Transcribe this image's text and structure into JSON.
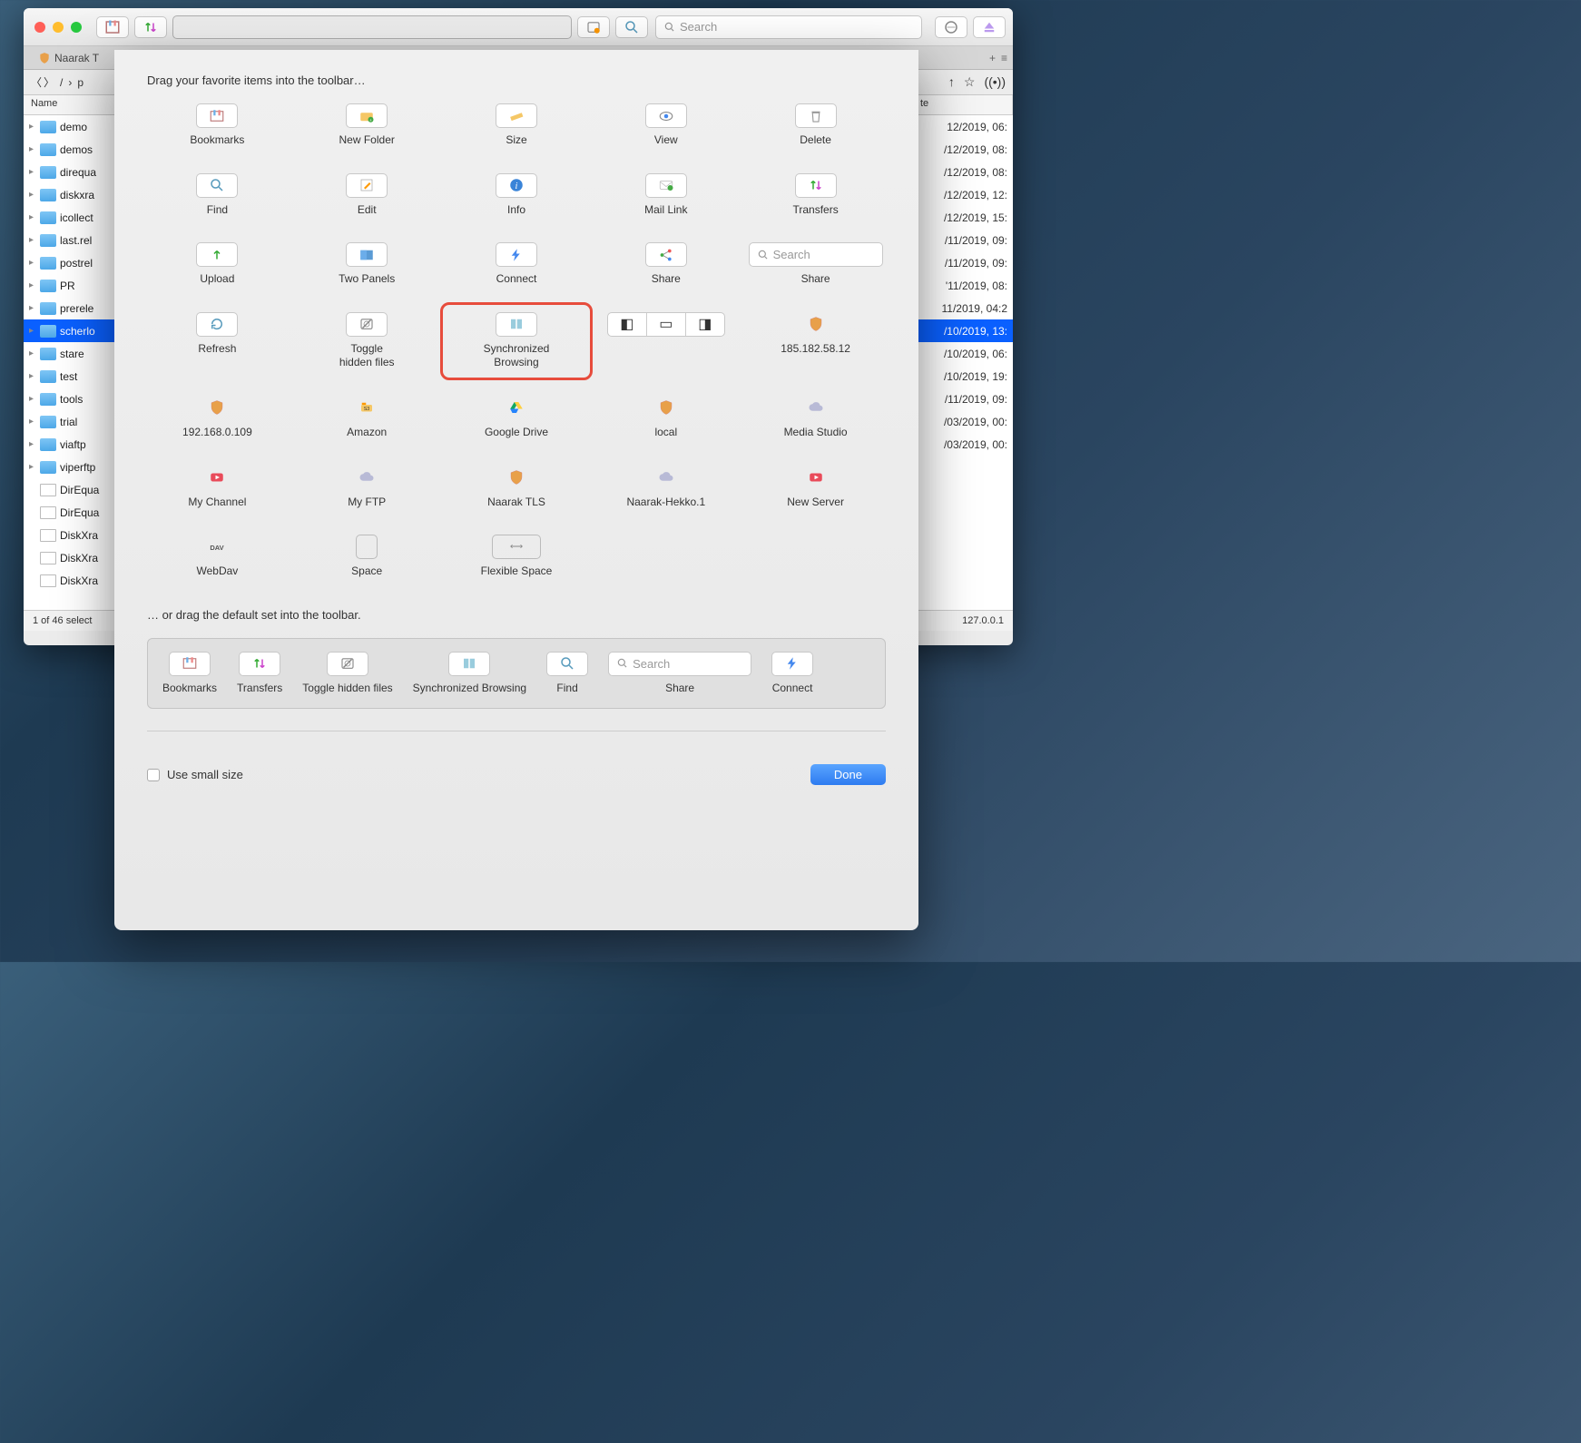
{
  "toolbar": {
    "search_placeholder": "Search"
  },
  "tab": {
    "title": "Naarak T"
  },
  "path": {
    "crumb": "p"
  },
  "columns": {
    "name": "Name",
    "date": "te"
  },
  "files": [
    {
      "name": "demo",
      "type": "folder",
      "date": "12/2019, 06:",
      "sel": false
    },
    {
      "name": "demos",
      "type": "folder",
      "date": "/12/2019, 08:",
      "sel": false
    },
    {
      "name": "direqua",
      "type": "folder",
      "date": "/12/2019, 08:",
      "sel": false
    },
    {
      "name": "diskxra",
      "type": "folder",
      "date": "/12/2019, 12:",
      "sel": false
    },
    {
      "name": "icollect",
      "type": "folder",
      "date": "/12/2019, 15:",
      "sel": false
    },
    {
      "name": "last.rel",
      "type": "folder",
      "date": "/11/2019, 09:",
      "sel": false
    },
    {
      "name": "postrel",
      "type": "folder",
      "date": "/11/2019, 09:",
      "sel": false
    },
    {
      "name": "PR",
      "type": "folder",
      "date": "'11/2019, 08:",
      "sel": false
    },
    {
      "name": "prerele",
      "type": "folder",
      "date": "11/2019, 04:2",
      "sel": false
    },
    {
      "name": "scherlo",
      "type": "folder",
      "date": "/10/2019, 13:",
      "sel": true
    },
    {
      "name": "stare",
      "type": "folder",
      "date": "/10/2019, 06:",
      "sel": false
    },
    {
      "name": "test",
      "type": "folder",
      "date": "/10/2019, 19:",
      "sel": false
    },
    {
      "name": "tools",
      "type": "folder",
      "date": "/11/2019, 09:",
      "sel": false
    },
    {
      "name": "trial",
      "type": "folder",
      "date": "/03/2019, 00:",
      "sel": false
    },
    {
      "name": "viaftp",
      "type": "folder",
      "date": "/03/2019, 00:",
      "sel": false
    },
    {
      "name": "viperftp",
      "type": "folder",
      "date": "",
      "sel": false
    },
    {
      "name": "DirEqua",
      "type": "doc",
      "date": "",
      "sel": false
    },
    {
      "name": "DirEqua",
      "type": "doc",
      "date": "",
      "sel": false
    },
    {
      "name": "DiskXra",
      "type": "doc",
      "date": "",
      "sel": false
    },
    {
      "name": "DiskXra",
      "type": "doc",
      "date": "",
      "sel": false
    },
    {
      "name": "DiskXra",
      "type": "doc",
      "date": "",
      "sel": false
    }
  ],
  "status": {
    "left": "1 of 46 select",
    "right": "127.0.0.1"
  },
  "sheet": {
    "title": "Drag your favorite items into the toolbar…",
    "row1": [
      {
        "label": "Bookmarks",
        "icon": "bookmarks"
      },
      {
        "label": "New Folder",
        "icon": "newfolder"
      },
      {
        "label": "Size",
        "icon": "ruler"
      },
      {
        "label": "View",
        "icon": "eye"
      },
      {
        "label": "Delete",
        "icon": "trash"
      }
    ],
    "row2": [
      {
        "label": "Find",
        "icon": "search"
      },
      {
        "label": "Edit",
        "icon": "edit"
      },
      {
        "label": "Info",
        "icon": "info"
      },
      {
        "label": "Mail Link",
        "icon": "mail"
      },
      {
        "label": "Transfers",
        "icon": "transfers"
      }
    ],
    "row3": [
      {
        "label": "Upload",
        "icon": "upload"
      },
      {
        "label": "Two Panels",
        "icon": "panels"
      },
      {
        "label": "Connect",
        "icon": "bolt"
      },
      {
        "label": "Share",
        "icon": "share"
      },
      {
        "label": "Share",
        "icon": "searchfield",
        "search": true,
        "placeholder": "Search"
      }
    ],
    "row4": [
      {
        "label": "Refresh",
        "icon": "refresh"
      },
      {
        "label": "Toggle\nhidden files",
        "icon": "hidden"
      },
      {
        "label": "Synchronized\nBrowsing",
        "icon": "sync",
        "highlight": true
      },
      {
        "label": "",
        "icon": "seg3",
        "seg": true
      },
      {
        "label": "185.182.58.12",
        "icon": "shield-orange",
        "nobtnframe": true
      }
    ],
    "row5": [
      {
        "label": "192.168.0.109",
        "icon": "shield-orange",
        "nobtnframe": true
      },
      {
        "label": "Amazon",
        "icon": "amazon",
        "nobtnframe": true
      },
      {
        "label": "Google Drive",
        "icon": "gdrive",
        "nobtnframe": true
      },
      {
        "label": "local",
        "icon": "shield-orange",
        "nobtnframe": true
      },
      {
        "label": "Media Studio",
        "icon": "cloud",
        "nobtnframe": true
      }
    ],
    "row6": [
      {
        "label": "My Channel",
        "icon": "youtube",
        "nobtnframe": true
      },
      {
        "label": "My FTP",
        "icon": "cloud",
        "nobtnframe": true
      },
      {
        "label": "Naarak TLS",
        "icon": "shield-orange",
        "nobtnframe": true
      },
      {
        "label": "Naarak-Hekko.1",
        "icon": "cloud",
        "nobtnframe": true
      },
      {
        "label": "New Server",
        "icon": "youtube",
        "nobtnframe": true
      }
    ],
    "row7": [
      {
        "label": "WebDav",
        "icon": "dav",
        "nobtnframe": true
      },
      {
        "label": "Space",
        "icon": "space",
        "space": true
      },
      {
        "label": "Flexible Space",
        "icon": "flex",
        "flex": true
      }
    ],
    "default_title": "… or drag the default set into the toolbar.",
    "defaults": [
      {
        "label": "Bookmarks",
        "icon": "bookmarks"
      },
      {
        "label": "Transfers",
        "icon": "transfers"
      },
      {
        "label": "Toggle hidden files",
        "icon": "hidden"
      },
      {
        "label": "Synchronized Browsing",
        "icon": "sync"
      },
      {
        "label": "Find",
        "icon": "search"
      },
      {
        "label": "Share",
        "icon": "searchfield",
        "search": true,
        "placeholder": "Search"
      },
      {
        "label": "Connect",
        "icon": "bolt"
      }
    ],
    "small_label": "Use small size",
    "done": "Done"
  }
}
